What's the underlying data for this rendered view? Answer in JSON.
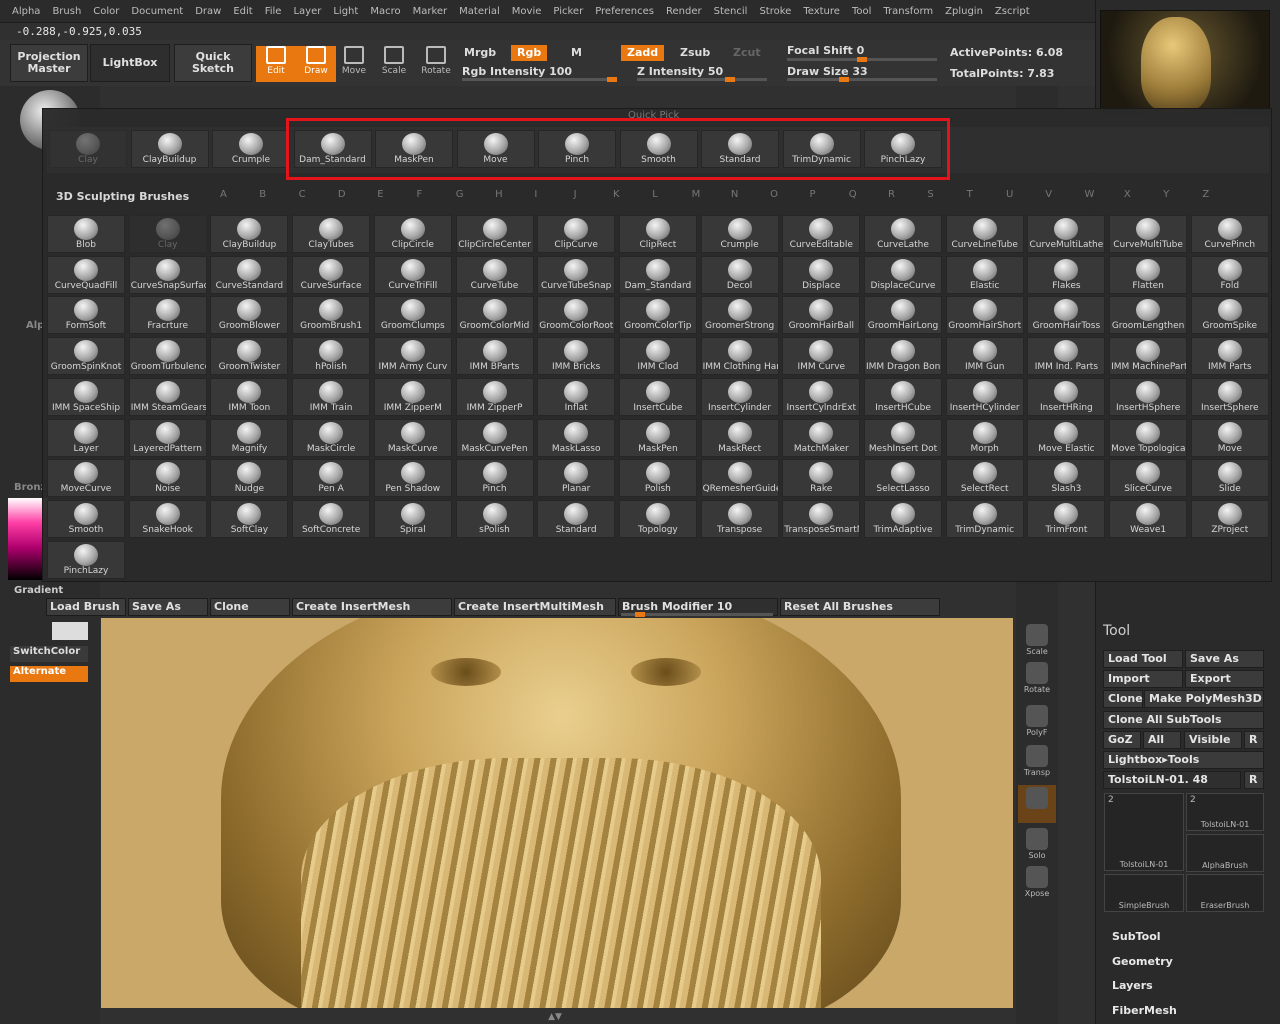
{
  "menu": [
    "Alpha",
    "Brush",
    "Color",
    "Document",
    "Draw",
    "Edit",
    "File",
    "Layer",
    "Light",
    "Macro",
    "Marker",
    "Material",
    "Movie",
    "Picker",
    "Preferences",
    "Render",
    "Stencil",
    "Stroke",
    "Texture",
    "Tool",
    "Transform",
    "Zplugin",
    "Zscript"
  ],
  "coords": "-0.288,-0.925,0.035",
  "toolbar": {
    "projection_master": "Projection Master",
    "lightbox": "LightBox",
    "quick_sketch": "Quick Sketch",
    "edit": "Edit",
    "draw": "Draw",
    "move": "Move",
    "scale": "Scale",
    "rotate": "Rotate",
    "mrgb": "Mrgb",
    "rgb": "Rgb",
    "m": "M",
    "zadd": "Zadd",
    "zsub": "Zsub",
    "zcut": "Zcut",
    "rgb_intensity": "Rgb Intensity 100",
    "z_intensity": "Z Intensity 50",
    "focal_shift": "Focal Shift 0",
    "draw_size": "Draw Size 33",
    "active_points": "ActivePoints: 6.08",
    "total_points": "TotalPoints: 7.83"
  },
  "quickpick": {
    "title": "Quick Pick",
    "items": [
      "Clay",
      "ClayBuildup",
      "Crumple",
      "Dam_Standard",
      "MaskPen",
      "Move",
      "Pinch",
      "Smooth",
      "Standard",
      "TrimDynamic",
      "PinchLazy"
    ]
  },
  "brushes": {
    "title": "3D Sculpting Brushes",
    "alpha": [
      "A",
      "B",
      "C",
      "D",
      "E",
      "F",
      "G",
      "H",
      "I",
      "J",
      "K",
      "L",
      "M",
      "N",
      "O",
      "P",
      "Q",
      "R",
      "S",
      "T",
      "U",
      "V",
      "W",
      "X",
      "Y",
      "Z"
    ],
    "items": [
      "Blob",
      "Clay",
      "ClayBuildup",
      "ClayTubes",
      "ClipCircle",
      "ClipCircleCenter",
      "ClipCurve",
      "ClipRect",
      "Crumple",
      "CurveEditable",
      "CurveLathe",
      "CurveLineTube",
      "CurveMultiLathe",
      "CurveMultiTube",
      "CurvePinch",
      "CurveQuadFill",
      "CurveSnapSurfac",
      "CurveStandard",
      "CurveSurface",
      "CurveTriFill",
      "CurveTube",
      "CurveTubeSnap",
      "Dam_Standard",
      "Decol",
      "Displace",
      "DisplaceCurve",
      "Elastic",
      "Flakes",
      "Flatten",
      "Fold",
      "FormSoft",
      "Fracrture",
      "GroomBlower",
      "GroomBrush1",
      "GroomClumps",
      "GroomColorMid",
      "GroomColorRoot",
      "GroomColorTip",
      "GroomerStrong",
      "GroomHairBall",
      "GroomHairLong",
      "GroomHairShort",
      "GroomHairToss",
      "GroomLengthen",
      "GroomSpike",
      "GroomSpinKnot",
      "GroomTurbulence",
      "GroomTwister",
      "hPolish",
      "IMM Army Curv",
      "IMM BParts",
      "IMM Bricks",
      "IMM Clod",
      "IMM Clothing Har",
      "IMM Curve",
      "IMM Dragon Bon",
      "IMM Gun",
      "IMM Ind. Parts",
      "IMM MachinePart",
      "IMM Parts",
      "IMM SpaceShip",
      "IMM SteamGears",
      "IMM Toon",
      "IMM Train",
      "IMM ZipperM",
      "IMM ZipperP",
      "Inflat",
      "InsertCube",
      "InsertCylinder",
      "InsertCylndrExt",
      "InsertHCube",
      "InsertHCylinder",
      "InsertHRing",
      "InsertHSphere",
      "InsertSphere",
      "Layer",
      "LayeredPattern",
      "Magnify",
      "MaskCircle",
      "MaskCurve",
      "MaskCurvePen",
      "MaskLasso",
      "MaskPen",
      "MaskRect",
      "MatchMaker",
      "MeshInsert Dot",
      "Morph",
      "Move Elastic",
      "Move Topological",
      "Move",
      "MoveCurve",
      "Noise",
      "Nudge",
      "Pen A",
      "Pen Shadow",
      "Pinch",
      "Planar",
      "Polish",
      "QRemesherGuide",
      "Rake",
      "SelectLasso",
      "SelectRect",
      "Slash3",
      "SliceCurve",
      "Slide",
      "Smooth",
      "SnakeHook",
      "SoftClay",
      "SoftConcrete",
      "Spiral",
      "sPolish",
      "Standard",
      "Topology",
      "Transpose",
      "TransposeSmartM",
      "TrimAdaptive",
      "TrimDynamic",
      "TrimFront",
      "Weave1",
      "ZProject",
      "PinchLazy"
    ]
  },
  "bottom": {
    "load_brush": "Load Brush",
    "save_as": "Save As",
    "clone": "Clone",
    "create_insert": "Create InsertMesh",
    "create_multi": "Create InsertMultiMesh",
    "brush_modifier": "Brush Modifier 10",
    "brush_modifier_value": 10,
    "reset": "Reset All Brushes"
  },
  "left": {
    "gradient": "Gradient",
    "switchcolor": "SwitchColor",
    "alternate": "Alternate",
    "alp": "Alp",
    "bronz": "Bronz"
  },
  "vtray": [
    "Scale",
    "Rotate",
    "PolyF",
    "Transp",
    "",
    "Solo",
    "Xpose"
  ],
  "tool": {
    "title": "Tool",
    "load": "Load Tool",
    "save": "Save As",
    "import": "Import",
    "export": "Export",
    "clone": "Clone",
    "make": "Make PolyMesh3D",
    "clone_all": "Clone All SubTools",
    "goz": "GoZ",
    "all": "All",
    "visible": "Visible",
    "r": "R",
    "lightbox": "Lightbox▸Tools",
    "name": "TolstoiLN-01. 48",
    "thumbs": [
      {
        "label": "TolstoiLN-01",
        "count": "2"
      },
      {
        "label": "TolstoiLN-01",
        "count": "2"
      },
      {
        "label": "AlphaBrush"
      },
      {
        "label": "SimpleBrush"
      },
      {
        "label": "EraserBrush"
      }
    ],
    "sections": [
      "SubTool",
      "Geometry",
      "Layers",
      "FiberMesh"
    ]
  },
  "colors": {
    "accent": "#e8780f",
    "highlight": "#e4141a"
  }
}
